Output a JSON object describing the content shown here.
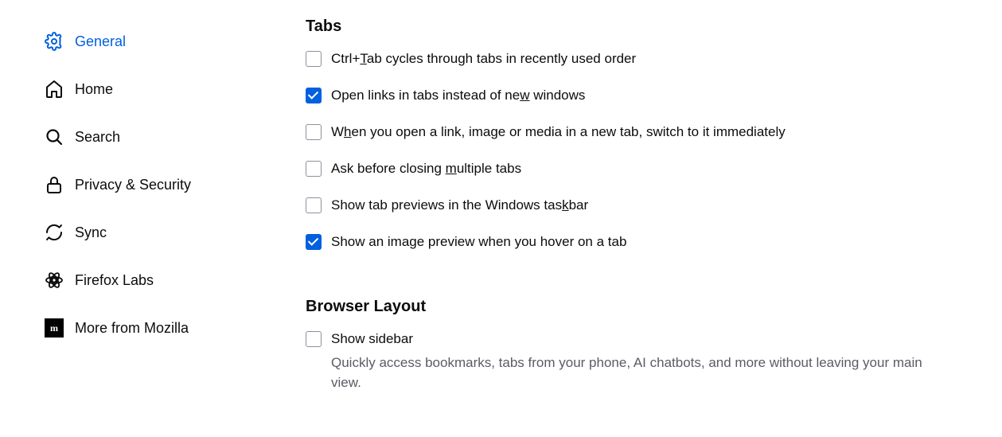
{
  "sidebar": {
    "items": [
      {
        "label": "General",
        "active": true
      },
      {
        "label": "Home",
        "active": false
      },
      {
        "label": "Search",
        "active": false
      },
      {
        "label": "Privacy & Security",
        "active": false
      },
      {
        "label": "Sync",
        "active": false
      },
      {
        "label": "Firefox Labs",
        "active": false
      },
      {
        "label": "More from Mozilla",
        "active": false
      }
    ]
  },
  "main": {
    "tabs": {
      "title": "Tabs",
      "options": [
        {
          "label_pre": "Ctrl+",
          "label_u": "T",
          "label_post": "ab cycles through tabs in recently used order",
          "checked": false
        },
        {
          "label_pre": "Open links in tabs instead of ne",
          "label_u": "w",
          "label_post": " windows",
          "checked": true
        },
        {
          "label_pre": "W",
          "label_u": "h",
          "label_post": "en you open a link, image or media in a new tab, switch to it immediately",
          "checked": false
        },
        {
          "label_pre": "Ask before closing ",
          "label_u": "m",
          "label_post": "ultiple tabs",
          "checked": false
        },
        {
          "label_pre": "Show tab previews in the Windows tas",
          "label_u": "k",
          "label_post": "bar",
          "checked": false
        },
        {
          "label_pre": "Show an image preview when you hover on a tab",
          "label_u": "",
          "label_post": "",
          "checked": true
        }
      ]
    },
    "browserLayout": {
      "title": "Browser Layout",
      "option": {
        "label": "Show sidebar",
        "checked": false
      },
      "desc": "Quickly access bookmarks, tabs from your phone, AI chatbots, and more without leaving your main view."
    }
  }
}
